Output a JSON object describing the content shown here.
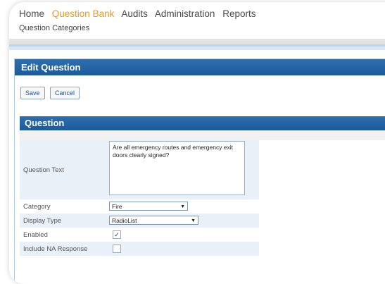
{
  "nav": {
    "items": [
      {
        "label": "Home",
        "active": false
      },
      {
        "label": "Question Bank",
        "active": true
      },
      {
        "label": "Audits",
        "active": false
      },
      {
        "label": "Administration",
        "active": false
      },
      {
        "label": "Reports",
        "active": false
      }
    ],
    "sub_label": "Question Categories",
    "active_color": "#f0961c"
  },
  "panel": {
    "title": "Edit Question",
    "save_label": "Save",
    "cancel_label": "Cancel",
    "header_color": "#1f5f9f"
  },
  "section": {
    "title": "Question"
  },
  "form": {
    "question_text_label": "Question Text",
    "question_text_value": "Are all emergency routes and emergency exit doors clearly signed?",
    "category_label": "Category",
    "category_value": "Fire",
    "display_type_label": "Display Type",
    "display_type_value": "RadioList",
    "enabled_label": "Enabled",
    "enabled_checked": true,
    "include_na_label": "Include NA Response",
    "include_na_checked": false,
    "dropdown_icon": "chevron-down-icon",
    "check_icon": "check-icon"
  }
}
